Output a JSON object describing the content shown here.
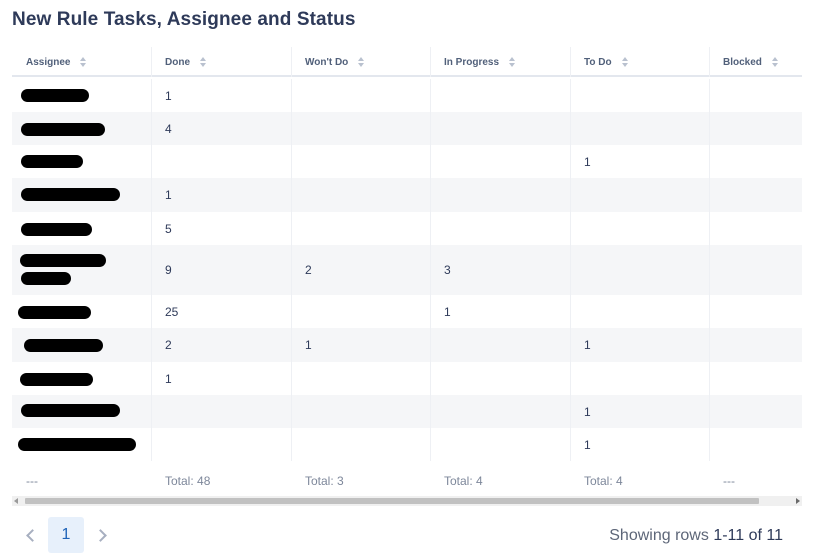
{
  "title": "New Rule Tasks, Assignee and Status",
  "columns": [
    "Assignee",
    "Done",
    "Won't Do",
    "In Progress",
    "To Do",
    "Blocked"
  ],
  "rows": [
    {
      "done": "1",
      "wont_do": "",
      "in_progress": "",
      "to_do": "",
      "blocked": ""
    },
    {
      "done": "4",
      "wont_do": "",
      "in_progress": "",
      "to_do": "",
      "blocked": ""
    },
    {
      "done": "",
      "wont_do": "",
      "in_progress": "",
      "to_do": "1",
      "blocked": ""
    },
    {
      "done": "1",
      "wont_do": "",
      "in_progress": "",
      "to_do": "",
      "blocked": ""
    },
    {
      "done": "5",
      "wont_do": "",
      "in_progress": "",
      "to_do": "",
      "blocked": ""
    },
    {
      "done": "9",
      "wont_do": "2",
      "in_progress": "3",
      "to_do": "",
      "blocked": ""
    },
    {
      "done": "25",
      "wont_do": "",
      "in_progress": "1",
      "to_do": "",
      "blocked": ""
    },
    {
      "done": "2",
      "wont_do": "1",
      "in_progress": "",
      "to_do": "1",
      "blocked": ""
    },
    {
      "done": "1",
      "wont_do": "",
      "in_progress": "",
      "to_do": "",
      "blocked": ""
    },
    {
      "done": "",
      "wont_do": "",
      "in_progress": "",
      "to_do": "1",
      "blocked": ""
    },
    {
      "done": "",
      "wont_do": "",
      "in_progress": "",
      "to_do": "1",
      "blocked": ""
    }
  ],
  "totals": {
    "assignee": "---",
    "done": "Total: 48",
    "wont_do": "Total: 3",
    "in_progress": "Total: 4",
    "to_do": "Total: 4",
    "blocked": "---"
  },
  "pagination": {
    "current_page": "1",
    "showing_prefix": "Showing rows",
    "showing_range": "1-11 of 11"
  }
}
